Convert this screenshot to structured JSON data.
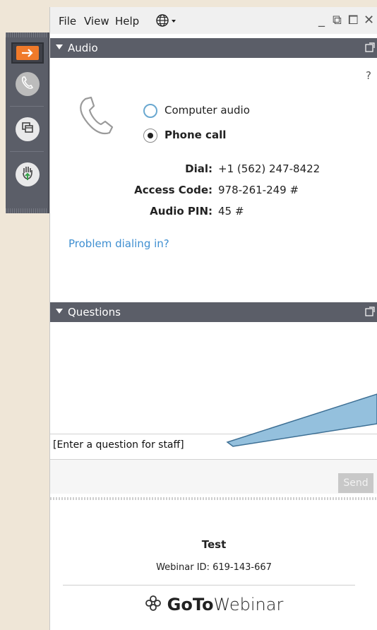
{
  "menu": {
    "file": "File",
    "view": "View",
    "help": "Help"
  },
  "window_controls": {
    "minimize": "_",
    "restore": "⧉",
    "popout": "⧠",
    "close": "✕"
  },
  "audio": {
    "header": "Audio",
    "help_mark": "?",
    "options": [
      {
        "label": "Computer audio",
        "selected": false
      },
      {
        "label": "Phone call",
        "selected": true
      }
    ],
    "dial_label": "Dial:",
    "dial_value": "+1 (562) 247-8422",
    "access_code_label": "Access Code:",
    "access_code_value": "978-261-249 #",
    "audio_pin_label": "Audio PIN:",
    "audio_pin_value": "45 #",
    "problem_link": "Problem dialing in?"
  },
  "questions": {
    "header": "Questions",
    "input_placeholder": "[Enter a question for staff]",
    "send_label": "Send"
  },
  "footer": {
    "title": "Test",
    "webinar_id": "Webinar ID: 619-143-667",
    "brand_bold": "GoTo",
    "brand_light": "Webinar"
  },
  "colors": {
    "accent_orange": "#f07a2a",
    "header_gray": "#5b5e68",
    "link_blue": "#3f8fd1"
  },
  "icons": [
    "arrow-right-icon",
    "phone-icon",
    "screen-share-icon",
    "raise-hand-icon",
    "globe-icon"
  ]
}
